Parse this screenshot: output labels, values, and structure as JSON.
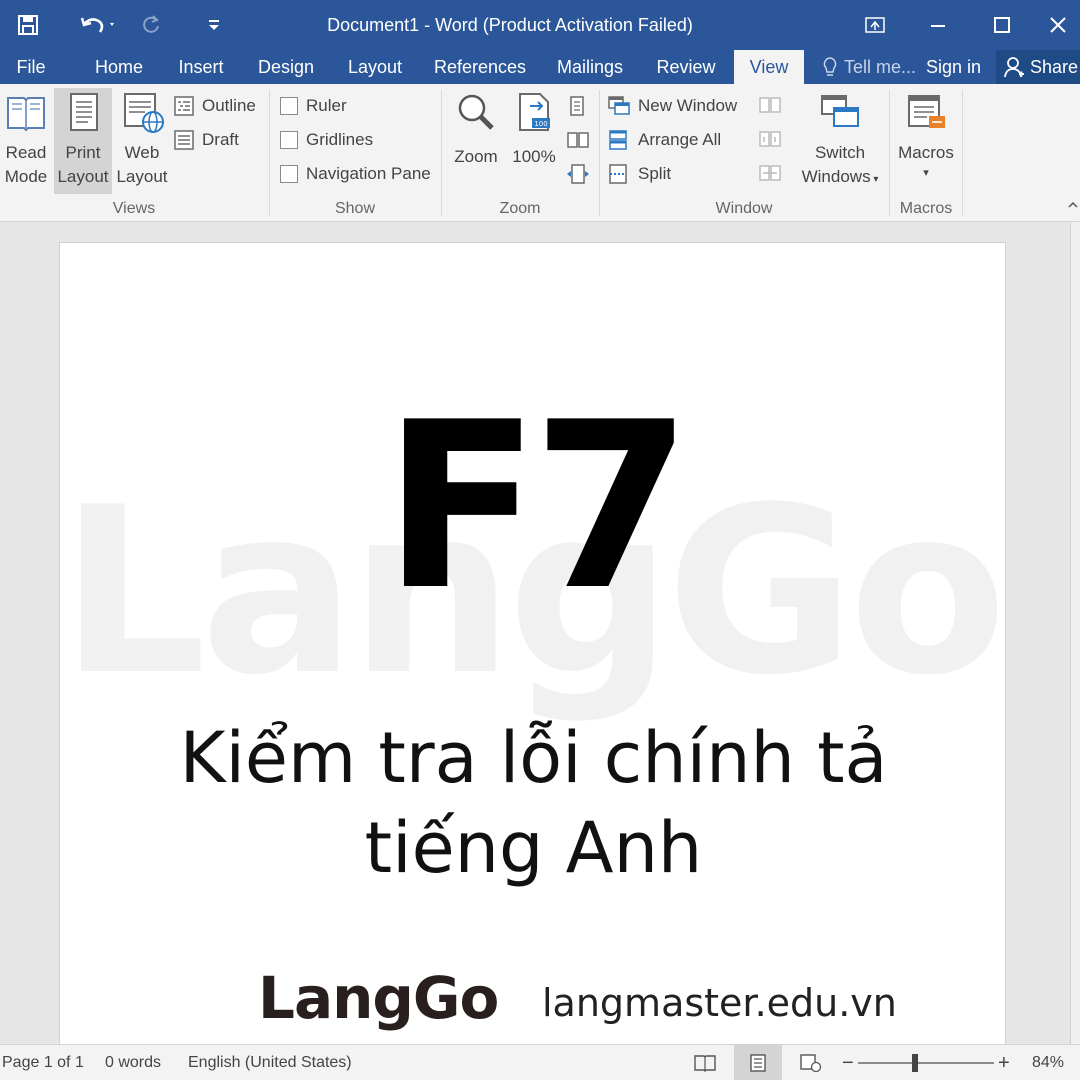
{
  "titlebar": {
    "title": "Document1 - Word (Product Activation Failed)",
    "save_icon": "save-icon",
    "undo_icon": "undo-icon",
    "redo_icon": "redo-icon",
    "customize_icon": "customize-qat-icon",
    "ribbon_display_icon": "ribbon-display-options-icon",
    "minimize_icon": "minimize-icon",
    "maximize_icon": "maximize-icon",
    "close_icon": "close-icon"
  },
  "tabs": [
    "File",
    "Home",
    "Insert",
    "Design",
    "Layout",
    "References",
    "Mailings",
    "Review",
    "View"
  ],
  "active_tab": "View",
  "tell_me": "Tell me...",
  "sign_in": "Sign in",
  "share": "Share",
  "ribbon": {
    "views": {
      "label": "Views",
      "read_mode": [
        "Read",
        "Mode"
      ],
      "print_layout": [
        "Print",
        "Layout"
      ],
      "web_layout": [
        "Web",
        "Layout"
      ],
      "outline": "Outline",
      "draft": "Draft"
    },
    "show": {
      "label": "Show",
      "ruler": "Ruler",
      "gridlines": "Gridlines",
      "navigation_pane": "Navigation Pane"
    },
    "zoom": {
      "label": "Zoom",
      "zoom": "Zoom",
      "hundred": "100%"
    },
    "window": {
      "label": "Window",
      "new_window": "New Window",
      "arrange_all": "Arrange All",
      "split": "Split",
      "switch_windows": [
        "Switch",
        "Windows"
      ]
    },
    "macros": {
      "label": "Macros",
      "macros": "Macros"
    }
  },
  "document": {
    "watermark": "LangGo",
    "heading": "F7",
    "caption_line1": "Kiểm tra lỗi chính tả",
    "caption_line2": "tiếng Anh",
    "brand": "LangGo",
    "website": "langmaster.edu.vn"
  },
  "statusbar": {
    "page": "Page 1 of 1",
    "words": "0 words",
    "language": "English (United States)",
    "zoom": "84%",
    "zoom_minus": "−",
    "zoom_plus": "+"
  }
}
